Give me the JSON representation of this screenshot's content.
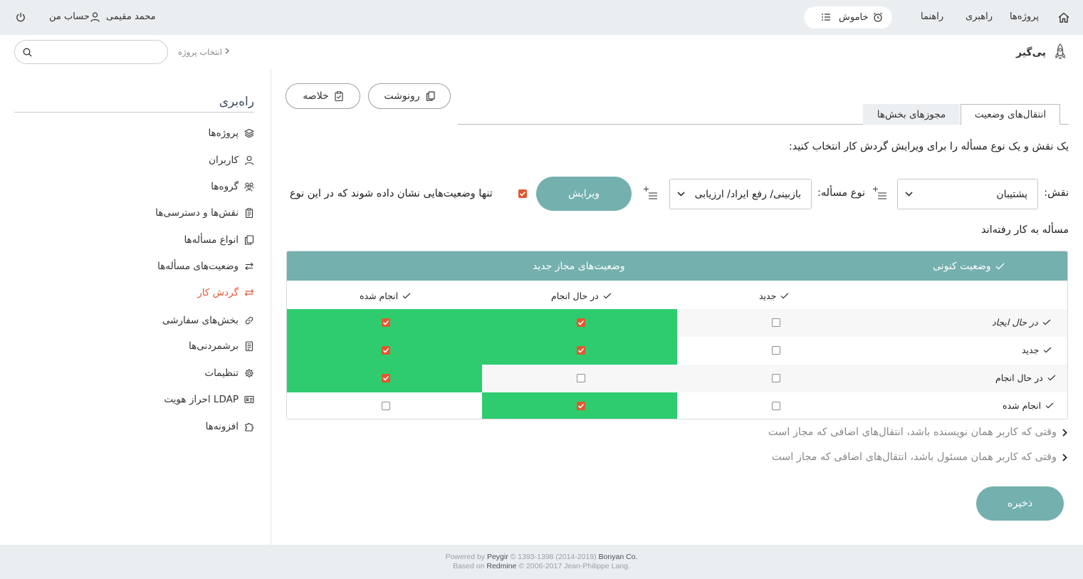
{
  "topbar": {
    "nav": {
      "projects": "پروژه‌ها",
      "administration": "راهبری",
      "help": "راهنما"
    },
    "status_label": "خاموش",
    "user_name": "محمد مقیمی",
    "my_account": "حساب من"
  },
  "header": {
    "breadcrumb": "انتخاب پروژه",
    "search_placeholder": "",
    "brand": "پی‌گیر"
  },
  "sidebar": {
    "title": "راه‌بری",
    "items": [
      {
        "label": "پروژه‌ها",
        "icon": "layers-icon"
      },
      {
        "label": "کاربران",
        "icon": "user-icon"
      },
      {
        "label": "گروه‌ها",
        "icon": "group-icon"
      },
      {
        "label": "نقش‌ها و دسترسی‌ها",
        "icon": "clipboard-icon"
      },
      {
        "label": "انواع مسأله‌ها",
        "icon": "copy-icon"
      },
      {
        "label": "وضعیت‌های مسأله‌ها",
        "icon": "arrows-icon"
      },
      {
        "label": "گردش کار",
        "icon": "swap-icon",
        "active": true
      },
      {
        "label": "بخش‌های سفارشی",
        "icon": "link-icon"
      },
      {
        "label": "برشمردنی‌ها",
        "icon": "list-doc-icon"
      },
      {
        "label": "تنظیمات",
        "icon": "gear-icon"
      },
      {
        "label": "احراز هویت LDAP",
        "icon": "id-card-icon"
      },
      {
        "label": "افزونه‌ها",
        "icon": "puzzle-icon"
      }
    ]
  },
  "toolbar": {
    "copy_label": "رونوشت",
    "summary_label": "خلاصه"
  },
  "tabs": {
    "transitions": "انتقال‌های وضعیت",
    "permissions": "مجوزهای بخش‌ها"
  },
  "instruction": "یک نقش و یک نوع مسأله را برای ویرایش گردش کار انتخاب کنید:",
  "filters": {
    "role_label": "نقش:",
    "role_value": "پشتیبان",
    "tracker_label": "نوع مسأله:",
    "tracker_value": "بازبینی/ رفع ایراد/ ارزیابی",
    "edit_label": "ویرایش",
    "used_only_label": "تنها وضعیت‌هایی نشان داده شوند که در این نوع",
    "used_only_label_line2": "مسأله به کار رفته‌اند",
    "used_only_checked": true
  },
  "workflow_table": {
    "current_status_header": "وضعیت کنونی",
    "new_statuses_header": "وضعیت‌های مجاز جدید",
    "columns": [
      "جدید",
      "در حال انجام",
      "انجام شده"
    ],
    "rows": [
      {
        "label": "در حال ایجاد",
        "italic": true,
        "checked": [
          false,
          true,
          true
        ]
      },
      {
        "label": "جدید",
        "italic": false,
        "checked": [
          false,
          true,
          true
        ]
      },
      {
        "label": "در حال انجام",
        "italic": false,
        "checked": [
          false,
          false,
          true
        ]
      },
      {
        "label": "انجام شده",
        "italic": false,
        "checked": [
          false,
          true,
          false
        ]
      }
    ],
    "checked_color": "#2ecc6f",
    "header_color": "#74b0ae"
  },
  "collapsibles": {
    "author": "وقتی که کاربر همان نویسنده باشد، انتقال‌های اضافی که مجاز است",
    "assignee": "وقتی که کاربر همان مسئول باشد، انتقال‌های اضافی که مجاز است"
  },
  "save_label": "ذخیره",
  "footer": {
    "line1_prefix": "Powered by",
    "line1_brand": "Peygir",
    "line1_mid": "© 1393-1398 (2014-2019)",
    "line1_company": "Bonyan Co.",
    "line2_prefix": "Based on",
    "line2_brand": "Redmine",
    "line2_rest": "© 2006-2017 Jean-Philippe Lang."
  },
  "colors": {
    "accent": "#74b0ae",
    "active_nav": "#e45a3a",
    "checkbox_checked": "#e0582f"
  }
}
